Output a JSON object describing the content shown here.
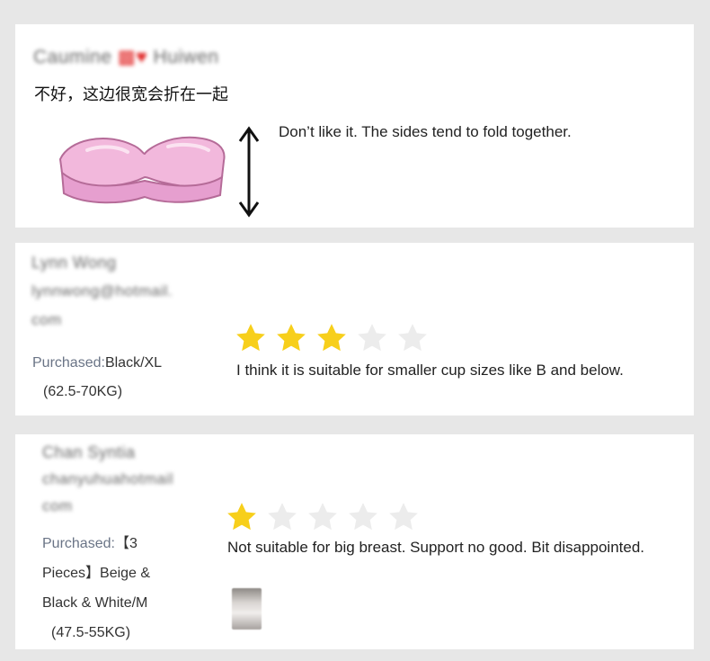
{
  "reviews": [
    {
      "reviewer": "Caumine",
      "reviewer_suffix": "Huiwen",
      "text_zh": "不好，这边很宽会折在一起",
      "text_en": "Don’t like it. The sides tend to fold together."
    },
    {
      "reviewer_line1": "Lynn Wong",
      "reviewer_line2": "lynnwong@hotmail.",
      "reviewer_line3": "com",
      "purchased_label": "Purchased:",
      "purchased_value": "Black/XL",
      "size_note": "(62.5-70KG)",
      "rating": 3,
      "rating_max": 5,
      "text_en": "I think it is suitable for smaller cup sizes like B and below."
    },
    {
      "reviewer_line1": "Chan Syntia",
      "reviewer_line2": "chanyuhuahotmail",
      "reviewer_line3": "com",
      "purchased_label": "Purchased:",
      "purchased_line1": "【3",
      "purchased_line2": "Pieces】Beige &",
      "purchased_line3": "Black & White/M",
      "size_note": "(47.5-55KG)",
      "rating": 1,
      "rating_max": 5,
      "text_en": "Not suitable for big breast. Support no good. Bit disappointed."
    }
  ],
  "colors": {
    "star_filled": "#f7cf1b",
    "star_empty": "#ececec",
    "bra_pink": "#f2b8dc",
    "page_bg": "#e7e7e7"
  }
}
